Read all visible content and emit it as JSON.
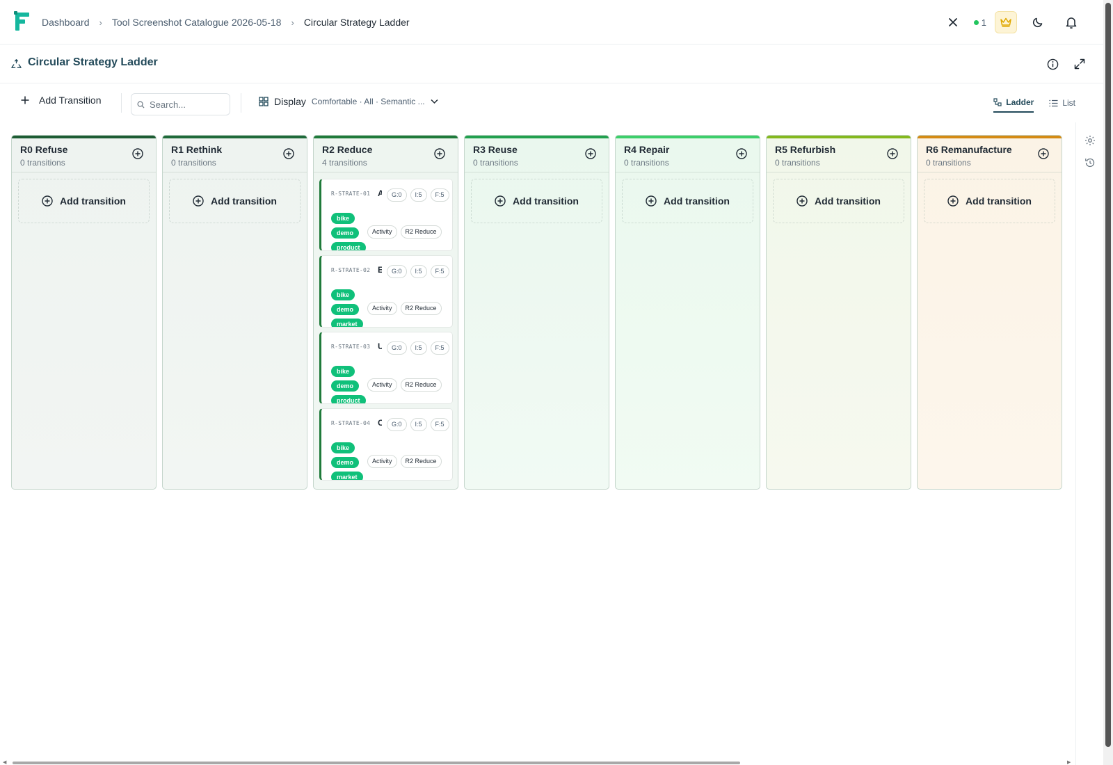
{
  "breadcrumb": [
    "Dashboard",
    "Tool Screenshot Catalogue 2026-05-18",
    "Circular Strategy Ladder"
  ],
  "header": {
    "online_count": "1"
  },
  "page": {
    "title": "Circular Strategy Ladder"
  },
  "toolbar": {
    "add_label": "Add Transition",
    "search_placeholder": "Search...",
    "display_label": "Display",
    "display_summary": "Comfortable · All · Semantic ...",
    "views": [
      {
        "label": "Ladder",
        "active": true
      },
      {
        "label": "List",
        "active": false
      }
    ]
  },
  "columns": [
    {
      "name": "R0 Refuse",
      "count": "0 transitions",
      "add_label": "Add transition",
      "accent": "#1d5c33",
      "bg_top": "#eef3f0",
      "bg_bot": "#f2f5f3"
    },
    {
      "name": "R1 Rethink",
      "count": "0 transitions",
      "add_label": "Add transition",
      "accent": "#1f6a3a",
      "bg_top": "#eef3f0",
      "bg_bot": "#f2f6f3"
    },
    {
      "name": "R2 Reduce",
      "count": "4 transitions",
      "add_label": "",
      "accent": "#1f7a3a",
      "bg_top": "#eef5f0",
      "bg_bot": "#f1f7f3"
    },
    {
      "name": "R3 Reuse",
      "count": "0 transitions",
      "add_label": "Add transition",
      "accent": "#22a04e",
      "bg_top": "#eaf7ee",
      "bg_bot": "#f1faf4"
    },
    {
      "name": "R4 Repair",
      "count": "0 transitions",
      "add_label": "Add transition",
      "accent": "#3ccf6a",
      "bg_top": "#eaf8ee",
      "bg_bot": "#f1fbf3"
    },
    {
      "name": "R5 Refurbish",
      "count": "0 transitions",
      "add_label": "Add transition",
      "accent": "#84b81d",
      "bg_top": "#f1f7ea",
      "bg_bot": "#f6f9ef"
    },
    {
      "name": "R6 Remanufacture",
      "count": "0 transitions",
      "add_label": "Add transition",
      "accent": "#d48a13",
      "bg_top": "#fbf3e6",
      "bg_bot": "#fdf6ec"
    }
  ],
  "cards": [
    {
      "id": "R-STRATE-01",
      "title": "A",
      "g": "G:0",
      "i": "I:5",
      "f": "F:5",
      "tags": [
        "bike",
        "demo",
        "product"
      ],
      "type": "Activity",
      "level": "R2 Reduce"
    },
    {
      "id": "R-STRATE-02",
      "title": "E",
      "g": "G:0",
      "i": "I:5",
      "f": "F:5",
      "tags": [
        "bike",
        "demo",
        "market"
      ],
      "type": "Activity",
      "level": "R2 Reduce"
    },
    {
      "id": "R-STRATE-03",
      "title": "U",
      "g": "G:0",
      "i": "I:5",
      "f": "F:5",
      "tags": [
        "bike",
        "demo",
        "product"
      ],
      "type": "Activity",
      "level": "R2 Reduce"
    },
    {
      "id": "R-STRATE-04",
      "title": "C",
      "g": "G:0",
      "i": "I:5",
      "f": "F:5",
      "tags": [
        "bike",
        "demo",
        "market"
      ],
      "type": "Activity",
      "level": "R2 Reduce"
    }
  ],
  "colors": {
    "brand": "#15b79e",
    "title": "#234a5a",
    "tag": "#10c07a",
    "online": "#22c55e"
  }
}
